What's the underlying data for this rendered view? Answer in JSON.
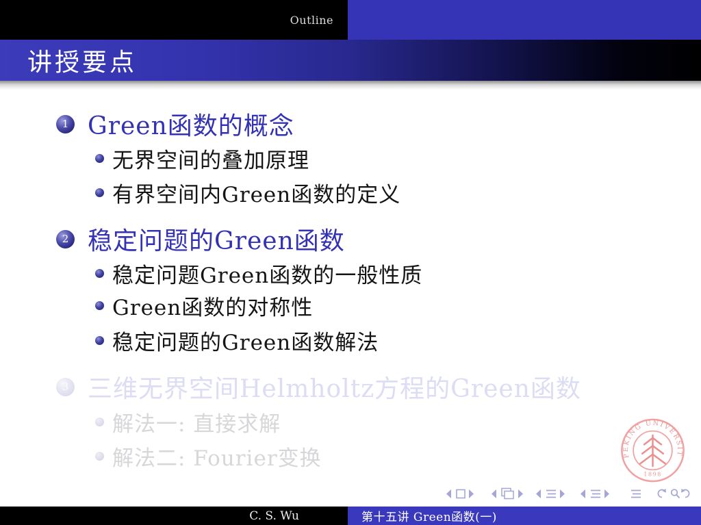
{
  "header": {
    "section": "Outline",
    "frame_title": "讲授要点"
  },
  "outline": {
    "items": [
      {
        "number": "1",
        "label": "Green函数的概念",
        "subitems": [
          "无界空间的叠加原理",
          "有界空间内Green函数的定义"
        ]
      },
      {
        "number": "2",
        "label": "稳定问题的Green函数",
        "subitems": [
          "稳定问题Green函数的一般性质",
          "Green函数的对称性",
          "稳定问题的Green函数解法"
        ]
      },
      {
        "number": "3",
        "label": "三维无界空间Helmholtz方程的Green函数",
        "subitems": [
          "解法一: 直接求解",
          "解法二: Fourier变换"
        ]
      }
    ]
  },
  "footer": {
    "author": "C. S. Wu",
    "lecture_title": "第十五讲  Green函数(一)"
  },
  "logo": {
    "arc_text": "PEKING UNIVERSITY",
    "year": "1898"
  },
  "nav_icons": [
    "prev-slide",
    "slide",
    "next-slide",
    "prev-frame",
    "frames",
    "next-frame",
    "prev-subsection",
    "subsection",
    "next-subsection",
    "prev-section",
    "section",
    "next-section",
    "appendix",
    "back",
    "search",
    "forward"
  ],
  "colors": {
    "header_blue": "#3634b6",
    "footer_blue": "#3a38bd",
    "title_gradient_left": "#3c3bba",
    "item_blue": "#3432b4",
    "ball_blue": "#26267e",
    "faded_lavender": "#dcdcf4",
    "faded_gray": "#d7d7da",
    "nav_symbols": "#a5a5d8",
    "logo_pink": "#ee8b8b"
  }
}
